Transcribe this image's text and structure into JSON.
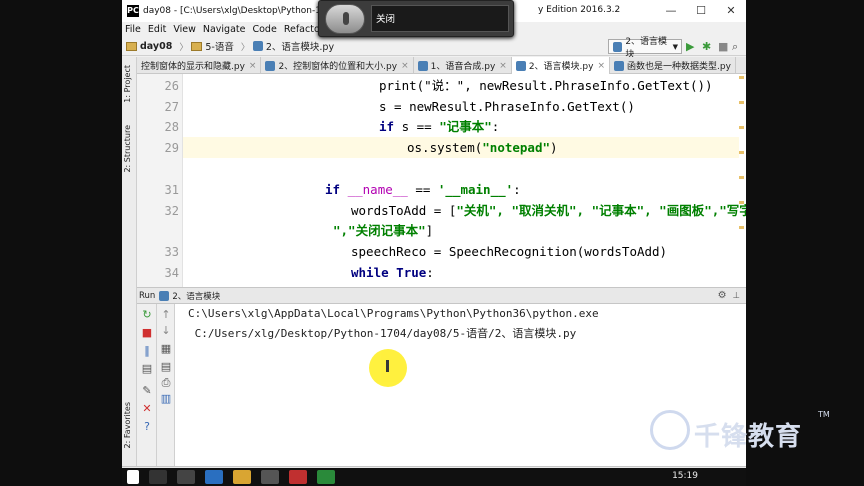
{
  "window": {
    "title": "day08 - [C:\\Users\\xlg\\Desktop\\Python-1704\\",
    "title_tail": "y Edition 2016.3.2",
    "min_label": "—",
    "max_label": "☐",
    "close_label": "✕"
  },
  "menu": [
    "File",
    "Edit",
    "View",
    "Navigate",
    "Code",
    "Refactor",
    "Ru"
  ],
  "breadcrumb": [
    "day08",
    "5-语音",
    "2、语言模块.py"
  ],
  "run_config": "2、语言模块",
  "sidebar_tabs": [
    "1: Project",
    "2: Structure",
    "2: Favorites"
  ],
  "tabs": [
    {
      "label": "控制窗体的显示和隐藏.py",
      "active": false
    },
    {
      "label": "2、控制窗体的位置和大小.py",
      "active": false
    },
    {
      "label": "1、语音合成.py",
      "active": false
    },
    {
      "label": "2、语言模块.py",
      "active": true
    },
    {
      "label": "函数也是一种数据类型.py",
      "active": false
    }
  ],
  "editor": {
    "line_numbers": [
      "26",
      "27",
      "28",
      "29",
      "",
      "31",
      "32",
      "",
      "33",
      "34"
    ],
    "code": {
      "l26": "print(\"说：\", newResult.PhraseInfo.GetText())",
      "l27": "s = newResult.PhraseInfo.GetText()",
      "l28_kw": "if",
      "l28_rest": " s == ",
      "l28_str": "\"记事本\"",
      "l28_end": ":",
      "l29_a": "os.system(",
      "l29_str": "\"notepad\"",
      "l29_b": ")",
      "l31_kw": "if",
      "l31_name": " __name__ ",
      "l31_op": "== ",
      "l31_str": "'__main__'",
      "l31_end": ":",
      "l32_a": "wordsToAdd = [",
      "l32_str": "\"关机\", \"取消关机\", \"记事本\", \"画图板\",\"写字板\",\"设置",
      "l32b_str": "\",\"关闭记事本\"",
      "l32b_end": "]",
      "l33": "speechReco = SpeechRecognition(wordsToAdd)",
      "l34_kw": "while",
      "l34_kw2": " True",
      "l34_end": ":"
    }
  },
  "run": {
    "label": "Run",
    "config": "2、语言模块",
    "console": [
      "C:\\Users\\xlg\\AppData\\Local\\Programs\\Python\\Python36\\python.exe",
      " C:/Users/xlg/Desktop/Python-1704/day08/5-语音/2、语言模块.py"
    ]
  },
  "popup": {
    "label": "关闭"
  },
  "taskbar": {
    "clock": "15:19"
  },
  "watermark": {
    "text": "千锋教育",
    "tm": "TM"
  },
  "colors": {
    "accent": "#4a7fb5",
    "keyword": "#000080",
    "string": "#008000",
    "cursor_highlight": "#ffef2a"
  }
}
